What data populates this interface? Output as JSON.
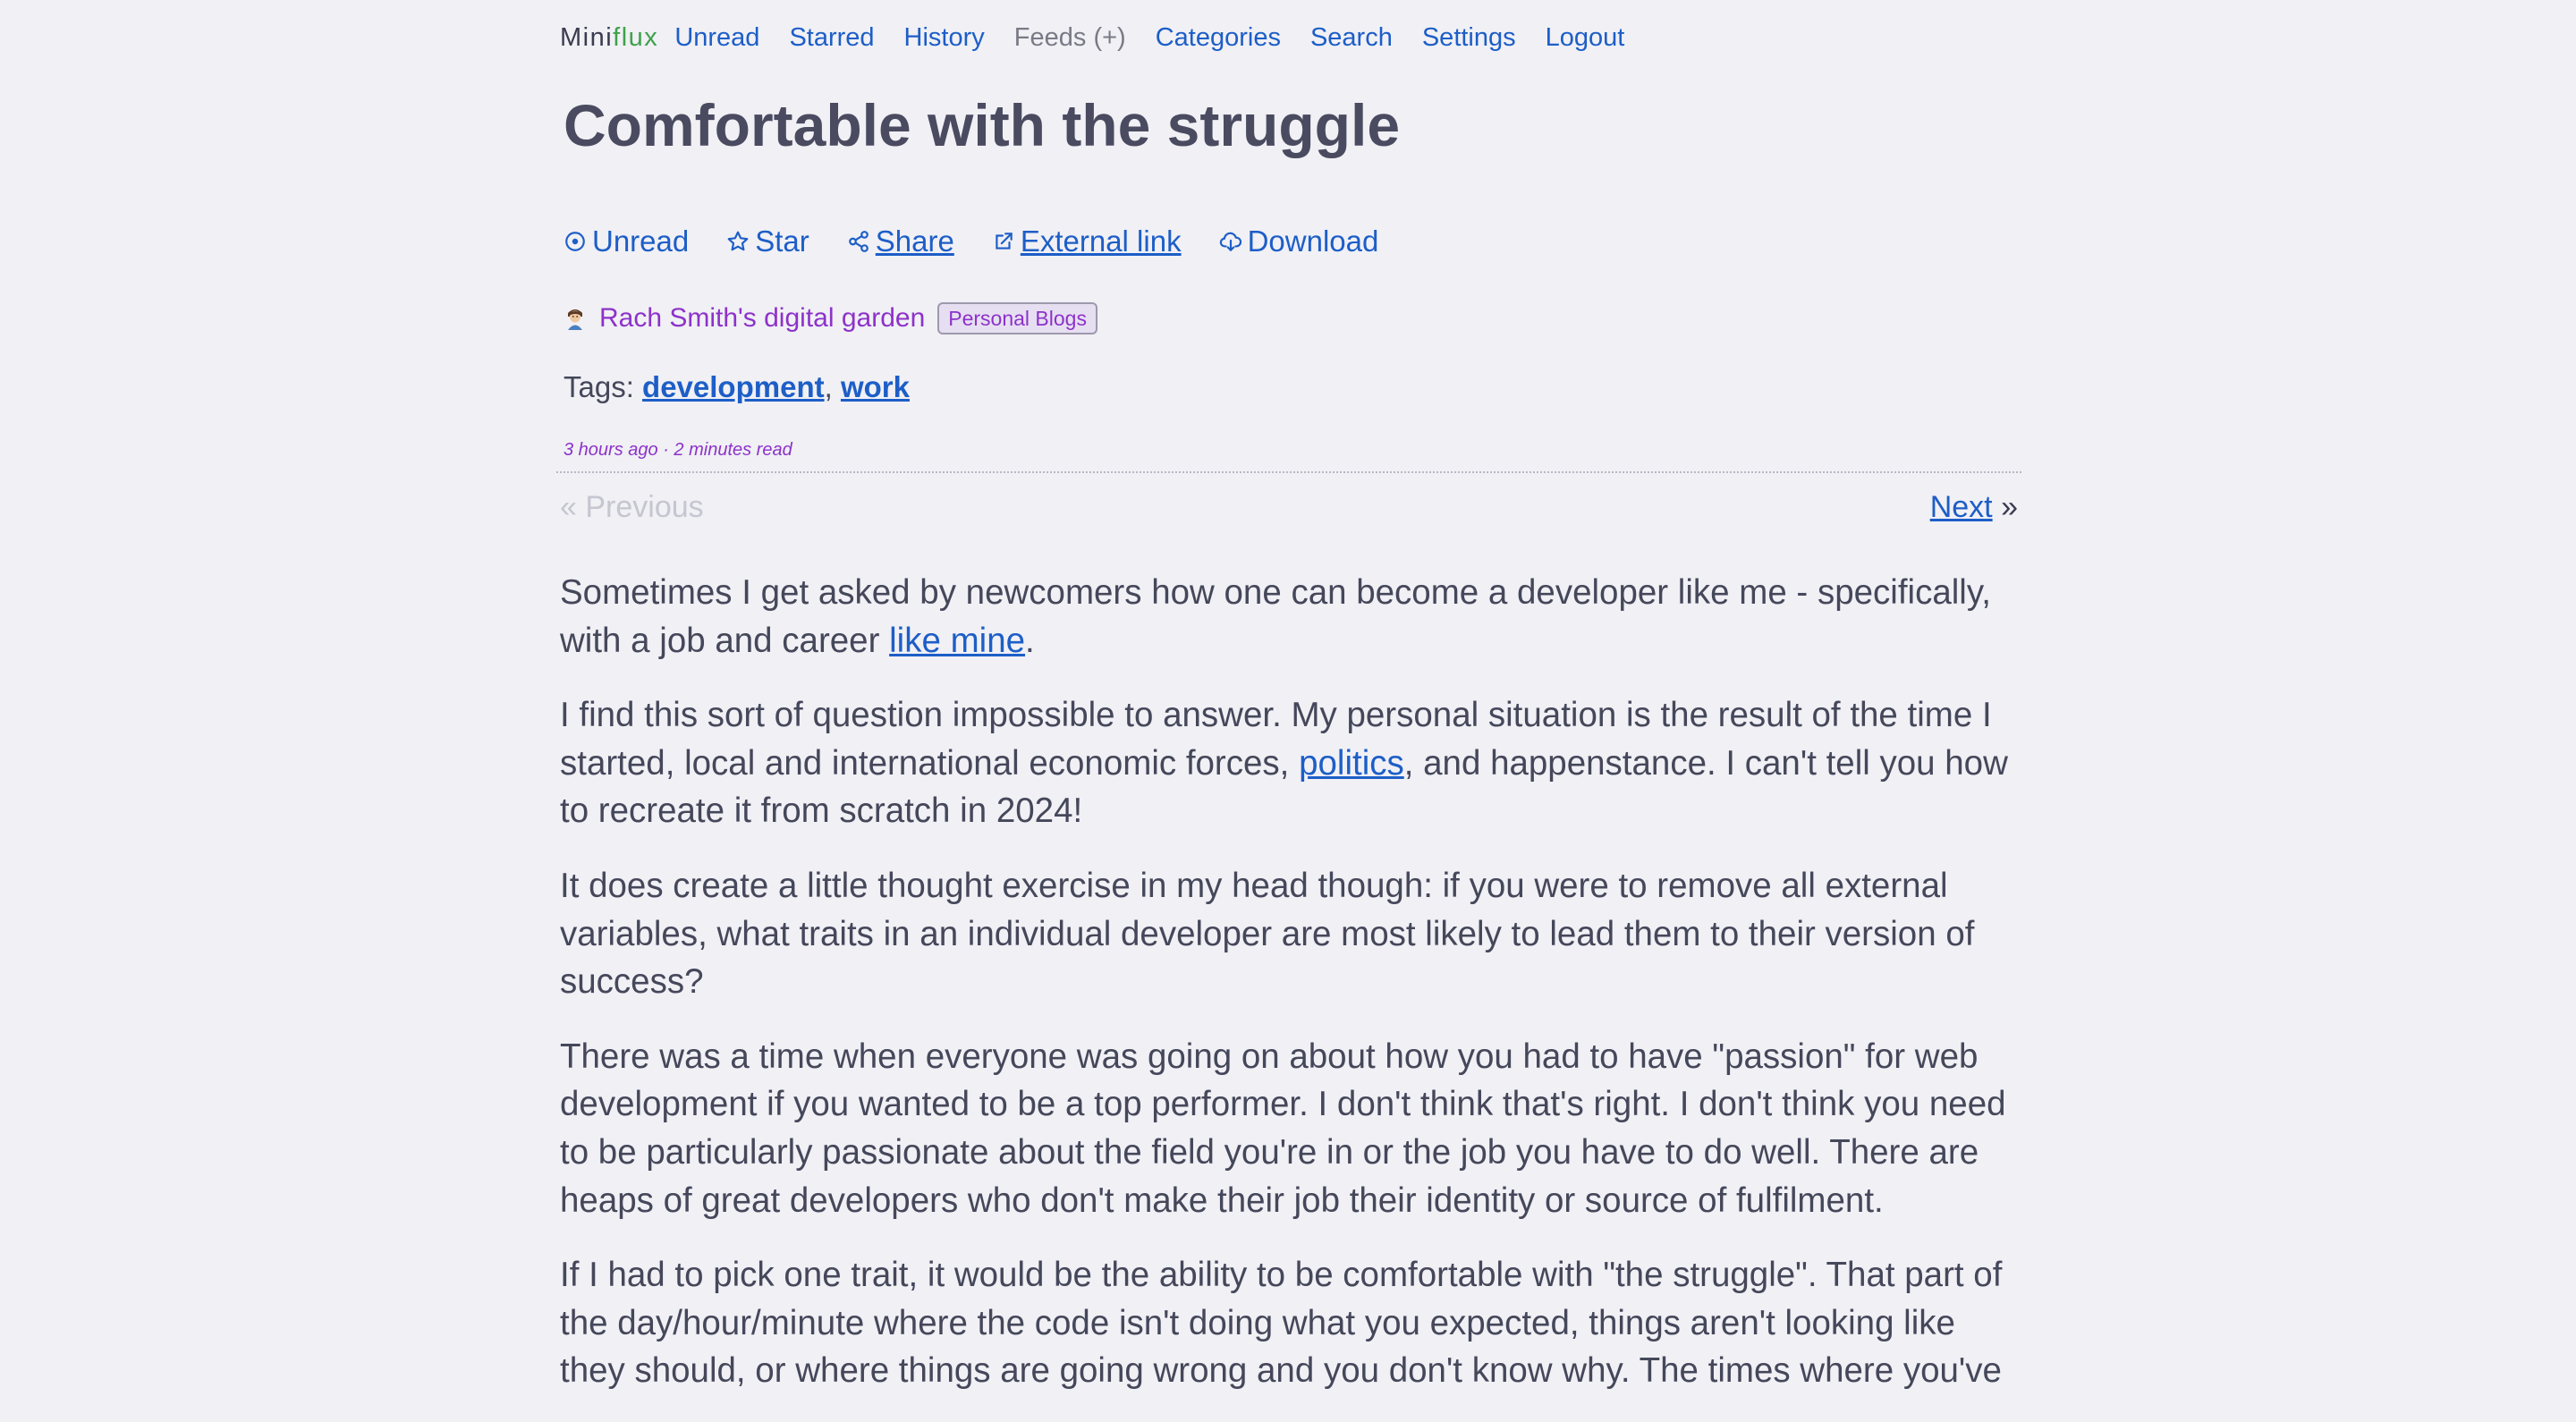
{
  "nav": {
    "logo_part1": "Mini",
    "logo_part2": "flux",
    "unread": "Unread",
    "starred": "Starred",
    "history": "History",
    "feeds": "Feeds (+)",
    "categories": "Categories",
    "search": "Search",
    "settings": "Settings",
    "logout": "Logout"
  },
  "entry": {
    "title": "Comfortable with the struggle",
    "actions": {
      "unread": "Unread",
      "star": "Star",
      "share": "Share",
      "external": "External link",
      "download": "Download"
    },
    "feed_name": "Rach Smith's digital garden",
    "category": "Personal Blogs",
    "tags_label": "Tags:",
    "tags": [
      "development",
      "work"
    ],
    "tag_separator": ",",
    "meta": "3 hours ago · 2 minutes read"
  },
  "pager": {
    "previous": "« Previous",
    "next": "Next",
    "next_arrow": "»"
  },
  "content": {
    "p1_before": "Sometimes I get asked by newcomers how one can become a developer like me - specifically, with a job and career ",
    "p1_link": "like mine",
    "p1_after": ".",
    "p2_before": "I find this sort of question impossible to answer. My personal situation is the result of the time I started, local and international economic forces, ",
    "p2_link": "politics",
    "p2_after": ", and happenstance. I can't tell you how to recreate it from scratch in 2024!",
    "p3": "It does create a little thought exercise in my head though: if you were to remove all external variables, what traits in an individual developer are most likely to lead them to their version of success?",
    "p4": "There was a time when everyone was going on about how you had to have \"passion\" for web development if you wanted to be a top performer. I don't think that's right. I don't think you need to be particularly passionate about the field you're in or the job you have to do well. There are heaps of great developers who don't make their job their identity or source of fulfilment.",
    "p5": "If I had to pick one trait, it would be the ability to be comfortable with \"the struggle\". That part of the day/hour/minute where the code isn't doing what you expected, things aren't looking like they should, or where things are going wrong and you don't know why. The times where you've"
  },
  "colors": {
    "background": "#f0f0f5",
    "link": "#1d5ec7",
    "feed": "#8d32c9",
    "logo_flux": "#3fa14a",
    "title": "#4a4b60"
  },
  "icons": {
    "unread": "unread-circle-icon",
    "star": "star-icon",
    "share": "share-icon",
    "external": "external-link-icon",
    "download": "cloud-download-icon",
    "favicon": "avatar-favicon"
  }
}
